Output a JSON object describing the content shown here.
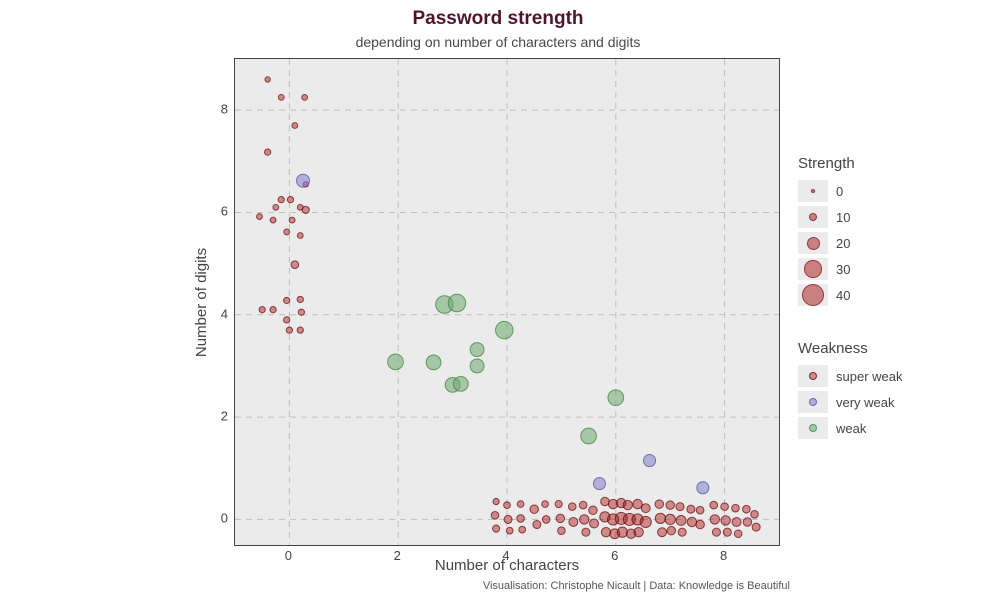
{
  "title": "Password strength",
  "subtitle": "depending on number of characters and digits",
  "xlabel": "Number of characters",
  "ylabel": "Number of digits",
  "caption": "Visualisation: Christophe Nicault | Data: Knowledge is Beautiful",
  "legend_size_title": "Strength",
  "legend_color_title": "Weakness",
  "legend_size": [
    {
      "label": "0",
      "strength": 0
    },
    {
      "label": "10",
      "strength": 10
    },
    {
      "label": "20",
      "strength": 20
    },
    {
      "label": "30",
      "strength": 30
    },
    {
      "label": "40",
      "strength": 40
    }
  ],
  "legend_color": [
    {
      "label": "super weak",
      "cls": "sw"
    },
    {
      "label": "very weak",
      "cls": "vw"
    },
    {
      "label": "weak",
      "cls": "wk"
    }
  ],
  "chart_data": {
    "type": "scatter",
    "xlabel": "Number of characters",
    "ylabel": "Number of digits",
    "xlim": [
      -1,
      9
    ],
    "ylim": [
      -0.5,
      9
    ],
    "x_ticks": [
      0,
      2,
      4,
      6,
      8
    ],
    "y_ticks": [
      0,
      2,
      4,
      6,
      8
    ],
    "size_var": "Strength",
    "size_breaks": [
      0,
      10,
      20,
      30,
      40
    ],
    "color_var": "Weakness",
    "color_levels": [
      "super weak",
      "very weak",
      "weak"
    ],
    "series": [
      {
        "name": "weak",
        "cls": "wk",
        "points": [
          {
            "x": 1.95,
            "y": 3.08,
            "s": 26
          },
          {
            "x": 2.65,
            "y": 3.07,
            "s": 24
          },
          {
            "x": 2.85,
            "y": 4.2,
            "s": 30
          },
          {
            "x": 3.08,
            "y": 4.23,
            "s": 30
          },
          {
            "x": 3.0,
            "y": 2.63,
            "s": 24
          },
          {
            "x": 3.15,
            "y": 2.65,
            "s": 24
          },
          {
            "x": 3.45,
            "y": 3.0,
            "s": 22
          },
          {
            "x": 3.45,
            "y": 3.32,
            "s": 22
          },
          {
            "x": 3.95,
            "y": 3.7,
            "s": 30
          },
          {
            "x": 5.5,
            "y": 1.63,
            "s": 26
          },
          {
            "x": 6.0,
            "y": 2.38,
            "s": 26
          }
        ]
      },
      {
        "name": "very weak",
        "cls": "vw",
        "points": [
          {
            "x": 0.25,
            "y": 6.62,
            "s": 20
          },
          {
            "x": 5.7,
            "y": 0.7,
            "s": 18
          },
          {
            "x": 6.62,
            "y": 1.15,
            "s": 18
          },
          {
            "x": 7.6,
            "y": 0.62,
            "s": 18
          }
        ]
      },
      {
        "name": "super weak",
        "cls": "sw",
        "points": [
          {
            "x": -0.4,
            "y": 8.6,
            "s": 3
          },
          {
            "x": -0.15,
            "y": 8.25,
            "s": 4
          },
          {
            "x": 0.28,
            "y": 8.25,
            "s": 4
          },
          {
            "x": 0.1,
            "y": 7.7,
            "s": 4
          },
          {
            "x": -0.4,
            "y": 7.18,
            "s": 5
          },
          {
            "x": 0.3,
            "y": 6.55,
            "s": 3
          },
          {
            "x": -0.15,
            "y": 6.25,
            "s": 5
          },
          {
            "x": 0.02,
            "y": 6.25,
            "s": 5
          },
          {
            "x": -0.25,
            "y": 6.1,
            "s": 4
          },
          {
            "x": 0.2,
            "y": 6.1,
            "s": 4
          },
          {
            "x": 0.3,
            "y": 6.05,
            "s": 7
          },
          {
            "x": -0.55,
            "y": 5.92,
            "s": 4
          },
          {
            "x": -0.3,
            "y": 5.85,
            "s": 4
          },
          {
            "x": 0.05,
            "y": 5.85,
            "s": 4
          },
          {
            "x": -0.05,
            "y": 5.62,
            "s": 4
          },
          {
            "x": 0.2,
            "y": 5.55,
            "s": 4
          },
          {
            "x": 0.1,
            "y": 4.98,
            "s": 8
          },
          {
            "x": 0.2,
            "y": 4.3,
            "s": 5
          },
          {
            "x": -0.05,
            "y": 4.28,
            "s": 5
          },
          {
            "x": -0.5,
            "y": 4.1,
            "s": 5
          },
          {
            "x": -0.3,
            "y": 4.1,
            "s": 5
          },
          {
            "x": 0.22,
            "y": 4.05,
            "s": 5
          },
          {
            "x": -0.05,
            "y": 3.9,
            "s": 5
          },
          {
            "x": 0.0,
            "y": 3.7,
            "s": 5
          },
          {
            "x": 0.2,
            "y": 3.7,
            "s": 5
          },
          {
            "x": 3.8,
            "y": 0.35,
            "s": 5
          },
          {
            "x": 3.78,
            "y": 0.08,
            "s": 8
          },
          {
            "x": 3.8,
            "y": -0.18,
            "s": 7
          },
          {
            "x": 4.0,
            "y": 0.28,
            "s": 6
          },
          {
            "x": 4.02,
            "y": 0.0,
            "s": 9
          },
          {
            "x": 4.05,
            "y": -0.22,
            "s": 6
          },
          {
            "x": 4.25,
            "y": 0.3,
            "s": 6
          },
          {
            "x": 4.25,
            "y": 0.02,
            "s": 8
          },
          {
            "x": 4.28,
            "y": -0.2,
            "s": 6
          },
          {
            "x": 4.5,
            "y": 0.2,
            "s": 10
          },
          {
            "x": 4.55,
            "y": -0.1,
            "s": 9
          },
          {
            "x": 4.7,
            "y": 0.3,
            "s": 6
          },
          {
            "x": 4.72,
            "y": 0.0,
            "s": 8
          },
          {
            "x": 4.95,
            "y": 0.3,
            "s": 7
          },
          {
            "x": 4.98,
            "y": 0.02,
            "s": 10
          },
          {
            "x": 5.0,
            "y": -0.22,
            "s": 8
          },
          {
            "x": 5.2,
            "y": 0.25,
            "s": 8
          },
          {
            "x": 5.22,
            "y": -0.05,
            "s": 11
          },
          {
            "x": 5.4,
            "y": 0.28,
            "s": 8
          },
          {
            "x": 5.42,
            "y": 0.0,
            "s": 12
          },
          {
            "x": 5.45,
            "y": -0.25,
            "s": 9
          },
          {
            "x": 5.58,
            "y": 0.18,
            "s": 10
          },
          {
            "x": 5.6,
            "y": -0.08,
            "s": 11
          },
          {
            "x": 5.8,
            "y": 0.35,
            "s": 10
          },
          {
            "x": 5.8,
            "y": 0.05,
            "s": 14
          },
          {
            "x": 5.82,
            "y": -0.25,
            "s": 12
          },
          {
            "x": 5.95,
            "y": 0.3,
            "s": 12
          },
          {
            "x": 5.95,
            "y": 0.0,
            "s": 16
          },
          {
            "x": 5.98,
            "y": -0.28,
            "s": 13
          },
          {
            "x": 6.1,
            "y": 0.32,
            "s": 12
          },
          {
            "x": 6.1,
            "y": 0.02,
            "s": 18
          },
          {
            "x": 6.12,
            "y": -0.25,
            "s": 14
          },
          {
            "x": 6.22,
            "y": 0.28,
            "s": 12
          },
          {
            "x": 6.25,
            "y": 0.0,
            "s": 18
          },
          {
            "x": 6.28,
            "y": -0.28,
            "s": 12
          },
          {
            "x": 6.4,
            "y": 0.3,
            "s": 12
          },
          {
            "x": 6.4,
            "y": 0.0,
            "s": 16
          },
          {
            "x": 6.42,
            "y": -0.25,
            "s": 12
          },
          {
            "x": 6.55,
            "y": 0.22,
            "s": 11
          },
          {
            "x": 6.55,
            "y": -0.05,
            "s": 16
          },
          {
            "x": 6.8,
            "y": 0.3,
            "s": 10
          },
          {
            "x": 6.82,
            "y": 0.02,
            "s": 14
          },
          {
            "x": 6.85,
            "y": -0.25,
            "s": 11
          },
          {
            "x": 7.0,
            "y": 0.28,
            "s": 10
          },
          {
            "x": 7.0,
            "y": 0.0,
            "s": 14
          },
          {
            "x": 7.02,
            "y": -0.22,
            "s": 10
          },
          {
            "x": 7.18,
            "y": 0.25,
            "s": 9
          },
          {
            "x": 7.2,
            "y": -0.02,
            "s": 13
          },
          {
            "x": 7.22,
            "y": -0.25,
            "s": 9
          },
          {
            "x": 7.38,
            "y": 0.2,
            "s": 9
          },
          {
            "x": 7.4,
            "y": -0.05,
            "s": 12
          },
          {
            "x": 7.55,
            "y": 0.18,
            "s": 8
          },
          {
            "x": 7.55,
            "y": -0.1,
            "s": 10
          },
          {
            "x": 7.8,
            "y": 0.28,
            "s": 8
          },
          {
            "x": 7.82,
            "y": 0.0,
            "s": 12
          },
          {
            "x": 7.85,
            "y": -0.25,
            "s": 9
          },
          {
            "x": 8.0,
            "y": 0.25,
            "s": 8
          },
          {
            "x": 8.02,
            "y": -0.02,
            "s": 12
          },
          {
            "x": 8.05,
            "y": -0.25,
            "s": 9
          },
          {
            "x": 8.2,
            "y": 0.22,
            "s": 8
          },
          {
            "x": 8.22,
            "y": -0.05,
            "s": 11
          },
          {
            "x": 8.25,
            "y": -0.28,
            "s": 8
          },
          {
            "x": 8.4,
            "y": 0.2,
            "s": 8
          },
          {
            "x": 8.42,
            "y": -0.05,
            "s": 10
          },
          {
            "x": 8.55,
            "y": 0.1,
            "s": 8
          },
          {
            "x": 8.58,
            "y": -0.15,
            "s": 9
          }
        ]
      }
    ]
  }
}
